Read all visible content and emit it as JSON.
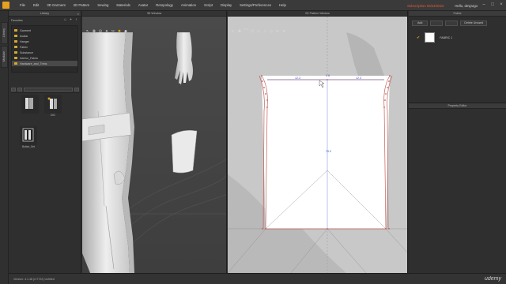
{
  "menu": {
    "items": [
      "File",
      "Edit",
      "3D Garment",
      "2D Pattern",
      "Sewing",
      "Materials",
      "Avatar",
      "Retopology",
      "Animation",
      "Script",
      "Display",
      "Settings/Preferences",
      "Help"
    ],
    "subscription": "Subscription 06/23/2022",
    "hello": "Hello, devjargo"
  },
  "left_strip": {
    "tabs": [
      "Library",
      "Modular"
    ]
  },
  "library": {
    "title": "Library",
    "favorites_label": "Favorites",
    "folders": [
      "Garment",
      "Avatar",
      "Hanger",
      "Fabric",
      "Substance",
      "Interior_Fabric",
      "Hardware_and_Trims"
    ],
    "selected_folder_index": 6,
    "thumbnails": [
      "",
      "DIG",
      "Button_Set"
    ]
  },
  "window3d": {
    "title": "3D Window"
  },
  "window2d": {
    "title": "2D Pattern Window",
    "measurements": {
      "top_left": "12.3",
      "top_center": "4.8",
      "top_right": "12.3",
      "center": "79.0"
    }
  },
  "fabric": {
    "title": "Fabric",
    "buttons": [
      "Add",
      "",
      "",
      "Delete Unused"
    ],
    "item_name": "FABRIC 1"
  },
  "property_editor": {
    "title": "Property Editor"
  },
  "status": {
    "version": "Version:  4.1.48 (r17722)    Untitled"
  },
  "watermark": "udemy",
  "colors": {
    "accent": "#e8a020",
    "subscription": "#e45a3a",
    "pattern_line": "#c0605a"
  }
}
